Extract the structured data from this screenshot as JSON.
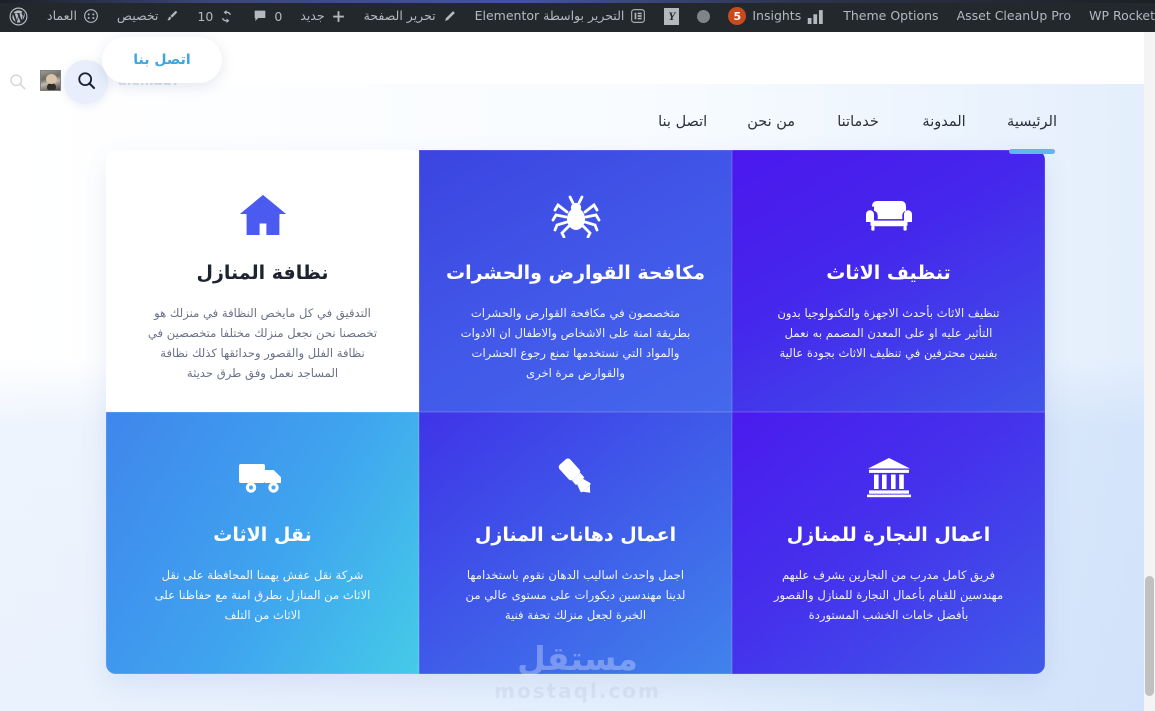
{
  "admin_bar": {
    "items": [
      {
        "label": "",
        "icon": "wordpress-logo-icon",
        "kind": "icon"
      },
      {
        "label": "",
        "icon": "dashboard-gauge-icon",
        "kind": "icon"
      },
      {
        "label": "العماد",
        "icon": "",
        "kind": "text"
      },
      {
        "label": "",
        "icon": "paintbrush-icon",
        "kind": "icon"
      },
      {
        "label": "تخصيص",
        "icon": "",
        "kind": "text"
      },
      {
        "label": "10",
        "icon": "refresh-update-icon",
        "kind": "count"
      },
      {
        "label": "0",
        "icon": "comment-bubble-icon",
        "kind": "count"
      },
      {
        "label": "جديد",
        "icon": "plus-icon",
        "kind": "text"
      },
      {
        "label": "تحرير الصفحة",
        "icon": "pencil-icon",
        "kind": "text"
      },
      {
        "label": "التحرير بواسطة Elementor",
        "icon": "elementor-icon",
        "kind": "text"
      },
      {
        "label": "",
        "icon": "yoast-seo-icon",
        "kind": "icon"
      },
      {
        "label": "",
        "icon": "gray-circle-icon",
        "kind": "icon"
      },
      {
        "label": "Insights",
        "icon": "analytics-bars-icon",
        "kind": "text"
      },
      {
        "label": "5",
        "icon": "",
        "kind": "badge"
      },
      {
        "label": "Theme Options",
        "icon": "",
        "kind": "text"
      },
      {
        "label": "Asset CleanUp Pro",
        "icon": "",
        "kind": "text"
      },
      {
        "label": "WP Rocket",
        "icon": "",
        "kind": "text"
      }
    ],
    "site_name": "العماد",
    "customize_label": "تخصيص",
    "update_count": "10",
    "comment_count": "0",
    "new_label": "جديد",
    "edit_page_label": "تحرير الصفحة",
    "elementor_label": "التحرير بواسطة Elementor",
    "insights_label": "Insights",
    "insights_badge": "5",
    "theme_options_label": "Theme Options",
    "asset_cleanup_label": "Asset CleanUp Pro",
    "wp_rocket_label": "WP Rocket"
  },
  "overlay": {
    "contact_pill_label": "اتصل بنا",
    "ghost_name": "alemad7",
    "search_icon": "search-magnifier-icon",
    "avatar_icon": "user-avatar-thumbnail"
  },
  "nav": {
    "items": [
      {
        "label": "الرئيسية",
        "active": true
      },
      {
        "label": "المدونة",
        "active": false
      },
      {
        "label": "خدماتنا",
        "active": false
      },
      {
        "label": "من نحن",
        "active": false
      },
      {
        "label": "اتصل بنا",
        "active": false
      }
    ]
  },
  "services": {
    "cards": [
      {
        "icon": "house-home-icon",
        "title": "نظافة المنازل",
        "desc": "التدقيق في كل مايخص النظافة في منزلك هو تخصصنا نحن نجعل منزلك مختلفا متخصصين في نظافة الفلل والقصور وحدائقها كذلك نظافة المساجد نعمل وفق طرق حديثة",
        "theme": "light"
      },
      {
        "icon": "spider-pest-icon",
        "title": "مكافحة القوارض والحشرات",
        "desc": "متخصصون في مكافحة القوارض والحشرات بطريقة امنة على الاشخاص والاطفال ان الادوات والمواد التي نستخدمها تمنع رجوع الحشرات والقوارض مرة اخرى",
        "theme": "dark"
      },
      {
        "icon": "sofa-couch-icon",
        "title": "تنظيف الاثاث",
        "desc": "تنظيف الاثاث بأحدث الاجهزة والتكنولوجيا بدون التأثير عليه او على المعدن المصمم به نعمل بفنيين محترفين في تنظيف الاثاث بجودة عالية",
        "theme": "dark"
      },
      {
        "icon": "moving-truck-icon",
        "title": "نقل الاثاث",
        "desc": "شركة نقل عفش يهمنا المحافظة على نقل الاثاث من المنازل بطرق امنة مع حفاظنا على الاثاث من التلف",
        "theme": "dark"
      },
      {
        "icon": "paint-brush-marker-icon",
        "title": "اعمال دهانات المنازل",
        "desc": "اجمل واحدث اساليب الدهان نقوم باستخدامها لدينا مهندسين ديكورات على مستوى عالي من الخبرة لجعل منزلك تحفة فنية",
        "theme": "dark"
      },
      {
        "icon": "classical-building-icon",
        "title": "اعمال النجارة للمنازل",
        "desc": "فريق كامل مدرب من النجارين يشرف عليهم مهندسين للقيام بأعمال النجارة للمنازل والقصور بأفضل خامات الخشب المستوردة",
        "theme": "dark"
      }
    ]
  },
  "watermark": {
    "arabic": "مستقل",
    "latin": "mostaql.com"
  },
  "colors": {
    "admin_bar_bg": "#23282d",
    "accent_blue": "#5bbbe8",
    "card_violet": "#4c18ee",
    "card_blue": "#3f56e8",
    "card_cyan": "#45cbe8",
    "badge_orange": "#ca4a1f",
    "pill_text": "#3ea6de"
  }
}
